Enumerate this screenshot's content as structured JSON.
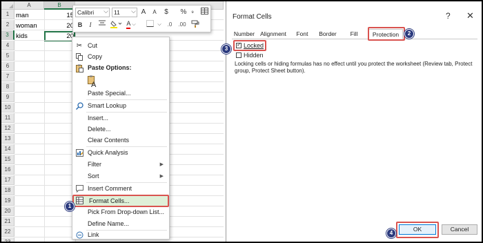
{
  "sheet": {
    "columns": [
      "A",
      "B"
    ],
    "rows": [
      "1",
      "2",
      "3",
      "4",
      "5",
      "6",
      "7",
      "8",
      "9",
      "10",
      "11",
      "12",
      "13",
      "14",
      "15",
      "16",
      "17",
      "18",
      "19",
      "20",
      "21",
      "22",
      "23"
    ],
    "cells": {
      "A1": "man",
      "B1": "15",
      "A2": "woman",
      "B2": "20",
      "A3": "kids",
      "B3": "20"
    }
  },
  "mini_toolbar": {
    "font_name": "Calibri",
    "font_size": "11",
    "grow_font": "A",
    "shrink_font": "A",
    "currency": "$",
    "percent": "%",
    "bold": "B",
    "italic": "I",
    "font_color": "A"
  },
  "context_menu": {
    "items": [
      {
        "label": "Cut",
        "icon": "scissors-icon"
      },
      {
        "label": "Copy",
        "icon": "copy-icon"
      },
      {
        "label": "Paste Options:",
        "icon": "paste-icon"
      },
      {
        "label": "Paste Special...",
        "icon": ""
      },
      {
        "label": "Smart Lookup",
        "icon": "search-icon"
      },
      {
        "label": "Insert...",
        "icon": ""
      },
      {
        "label": "Delete...",
        "icon": ""
      },
      {
        "label": "Clear Contents",
        "icon": ""
      },
      {
        "label": "Quick Analysis",
        "icon": "quick-analysis-icon"
      },
      {
        "label": "Filter",
        "icon": ""
      },
      {
        "label": "Sort",
        "icon": ""
      },
      {
        "label": "Insert Comment",
        "icon": "comment-icon"
      },
      {
        "label": "Format Cells...",
        "icon": "format-cells-icon"
      },
      {
        "label": "Pick From Drop-down List...",
        "icon": ""
      },
      {
        "label": "Define Name...",
        "icon": ""
      },
      {
        "label": "Link",
        "icon": "link-icon"
      }
    ]
  },
  "dialog": {
    "title": "Format Cells",
    "help": "?",
    "close": "✕",
    "tabs": [
      "Number",
      "Alignment",
      "Font",
      "Border",
      "Fill",
      "Protection"
    ],
    "active_tab": "Protection",
    "locked_label": "Locked",
    "locked_checked": true,
    "hidden_label": "Hidden",
    "hidden_checked": false,
    "note": "Locking cells or hiding formulas has no effect until you protect the worksheet (Review tab, Protect group, Protect Sheet button).",
    "ok_label": "OK",
    "cancel_label": "Cancel"
  },
  "callouts": [
    "1",
    "2",
    "3",
    "4"
  ],
  "colors": {
    "highlight": "#d9534f",
    "badge": "#2b3a7e",
    "excel_green": "#217346"
  }
}
